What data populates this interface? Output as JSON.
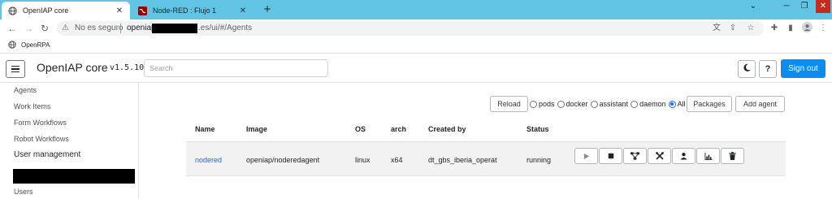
{
  "browser": {
    "tabs": [
      {
        "title": "OpenIAP core",
        "active": true,
        "icon": "globe-icon"
      },
      {
        "title": "Node-RED : Flujo 1",
        "active": false,
        "icon": "node-red-icon"
      }
    ],
    "new_tab_symbol": "+",
    "window_controls": {
      "chevron": "⌄",
      "minimize": "─",
      "restore": "❐",
      "close": "✕"
    },
    "security_label": "No es seguro",
    "url_prefix": "openiap.",
    "url_suffix": ".es/ui/#/Agents",
    "bookmarks": [
      {
        "label": "OpenRPA",
        "icon": "globe-icon"
      }
    ]
  },
  "colors": {
    "tabstrip": "#62c4e4",
    "primary": "#0d8cf0",
    "link": "#0d6efd",
    "row_bg": "#f2f2f2"
  },
  "header": {
    "brand": "OpenIAP core",
    "version": "v1.5.10",
    "search_placeholder": "Search",
    "theme_icon": "moon-icon",
    "help_label": "?",
    "signout_label": "Sign out"
  },
  "sidebar": {
    "items": [
      {
        "label": "Agents"
      },
      {
        "label": "Work Items"
      },
      {
        "label": "Form Workflows"
      },
      {
        "label": "Robot Workflows"
      },
      {
        "label": "User management"
      },
      {
        "label": "Users"
      }
    ]
  },
  "agents": {
    "reload_label": "Reload",
    "filters": [
      {
        "label": "pods",
        "checked": false
      },
      {
        "label": "docker",
        "checked": false
      },
      {
        "label": "assistant",
        "checked": false
      },
      {
        "label": "daemon",
        "checked": false
      },
      {
        "label": "All",
        "checked": true
      }
    ],
    "packages_label": "Packages",
    "add_agent_label": "Add agent",
    "columns": [
      "Name",
      "Image",
      "OS",
      "arch",
      "Created by",
      "Status"
    ],
    "rows": [
      {
        "name": "nodered",
        "image": "openiap/noderedagent",
        "os": "linux",
        "arch": "x64",
        "created_by": "dt_gbs_iberia_operat",
        "status": "running",
        "actions": [
          "play-icon",
          "stop-icon",
          "network-icon",
          "tools-icon",
          "user-icon",
          "chart-icon",
          "trash-icon"
        ]
      }
    ]
  }
}
